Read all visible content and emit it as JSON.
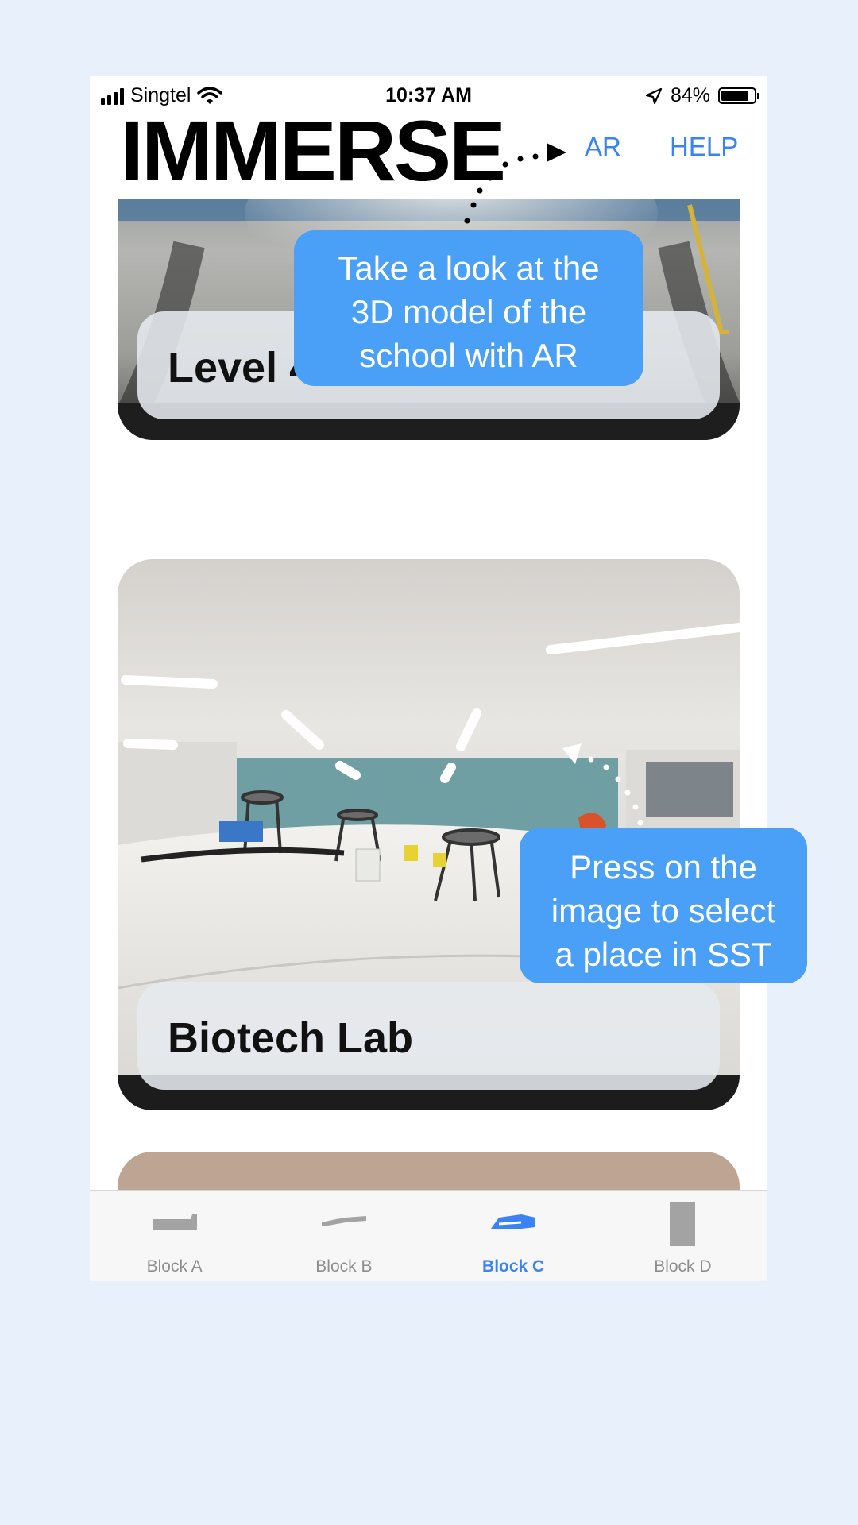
{
  "status_bar": {
    "carrier": "Singtel",
    "time": "10:37 AM",
    "battery": "84%",
    "battery_level": 0.84
  },
  "header": {
    "logo": "IMMERSE",
    "ar_label": "AR",
    "help_label": "HELP"
  },
  "cards": [
    {
      "label": "Level 4"
    },
    {
      "label": "Biotech Lab"
    },
    {
      "label": ""
    }
  ],
  "tabs": [
    {
      "label": "Block A",
      "icon": "block-a-building-icon",
      "active": false
    },
    {
      "label": "Block B",
      "icon": "block-b-building-icon",
      "active": false
    },
    {
      "label": "Block C",
      "icon": "block-c-building-icon",
      "active": true
    },
    {
      "label": "Block D",
      "icon": "block-d-building-icon",
      "active": false
    }
  ],
  "coach": {
    "ar_tip": [
      "Take a look at the",
      "3D model of the",
      "school with AR"
    ],
    "image_tip": [
      "Press on the",
      "image to select",
      "a place in SST"
    ]
  },
  "colors": {
    "accent": "#3b82f6",
    "bubble": "#4aa0f6",
    "background": "#e8f1fb"
  }
}
